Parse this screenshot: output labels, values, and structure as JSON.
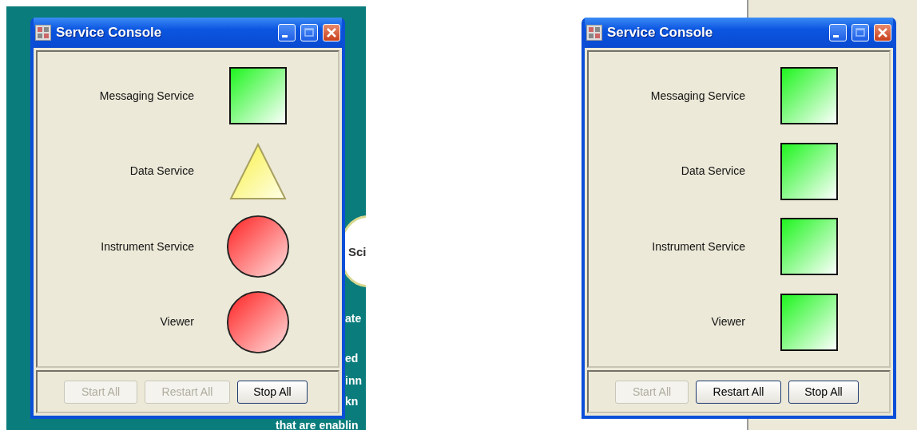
{
  "screens": [
    {
      "kind": "teal-page",
      "logo_text": "Sci",
      "background_texts": [
        "ate",
        "ed",
        "inn",
        "kn",
        "that are enablin"
      ],
      "window": {
        "title": "Service Console",
        "services": [
          {
            "name": "Messaging Service",
            "kind": "running"
          },
          {
            "name": "Data Service",
            "kind": "warning"
          },
          {
            "name": "Instrument Service",
            "kind": "stopped"
          },
          {
            "name": "Viewer",
            "kind": "stopped"
          }
        ],
        "buttons": [
          {
            "label": "Start All",
            "disabled": true
          },
          {
            "label": "Restart All",
            "disabled": true
          },
          {
            "label": "Stop All",
            "disabled": false
          }
        ]
      }
    },
    {
      "kind": "plain-page",
      "window": {
        "title": "Service Console",
        "services": [
          {
            "name": "Messaging Service",
            "kind": "running"
          },
          {
            "name": "Data Service",
            "kind": "running"
          },
          {
            "name": "Instrument Service",
            "kind": "running"
          },
          {
            "name": "Viewer",
            "kind": "running"
          }
        ],
        "buttons": [
          {
            "label": "Start All",
            "disabled": true
          },
          {
            "label": "Restart All",
            "disabled": false
          },
          {
            "label": "Stop All",
            "disabled": false
          }
        ]
      }
    }
  ]
}
